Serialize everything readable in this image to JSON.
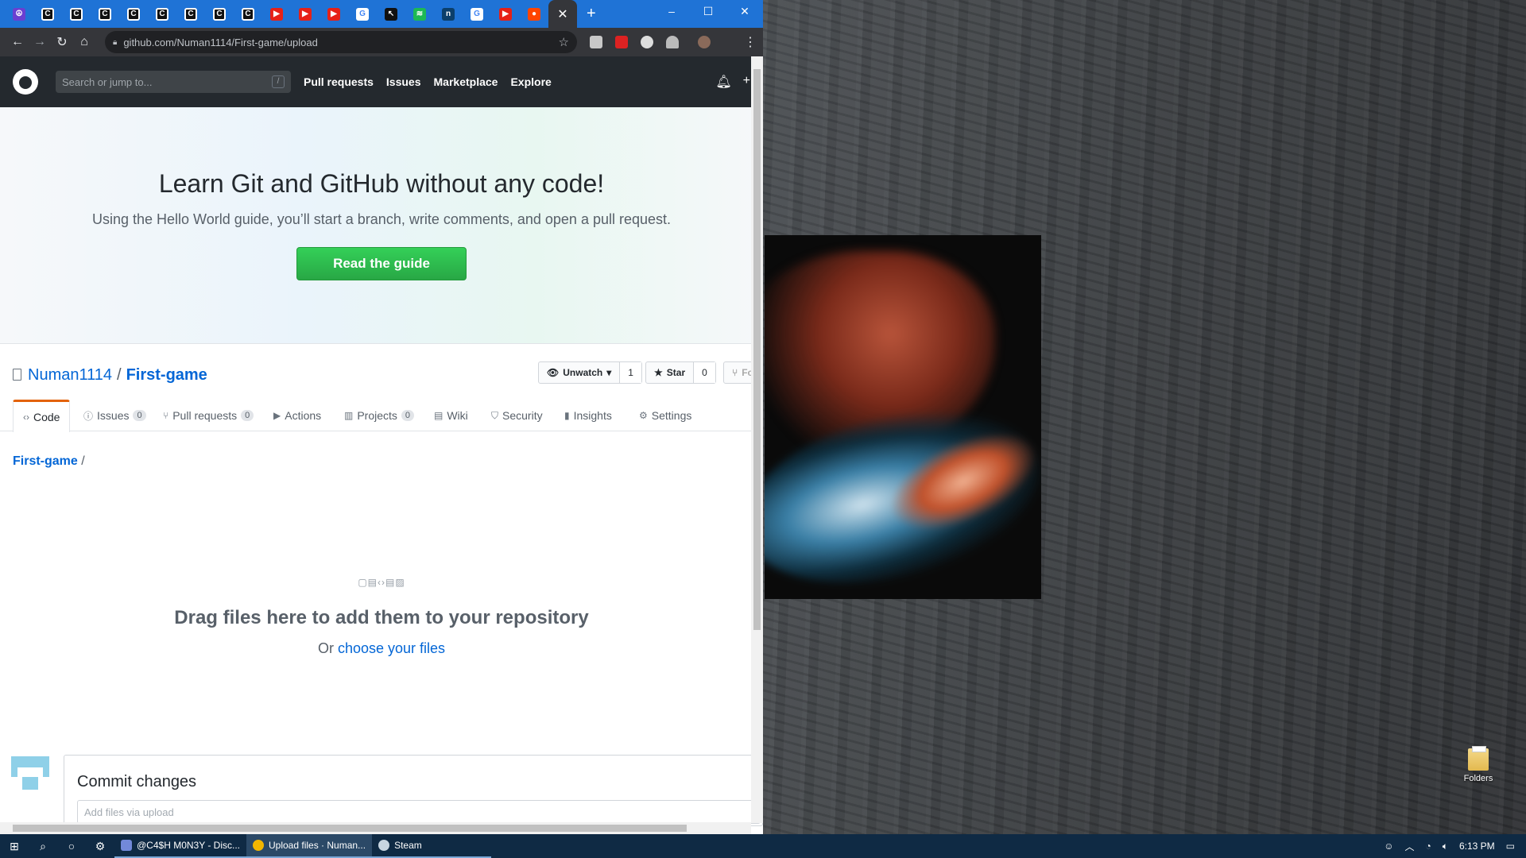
{
  "browser": {
    "tabs": [
      {
        "icon": "peace-icon",
        "color": "#6a3fd1",
        "glyph": "☮"
      },
      {
        "icon": "c-letter-icon",
        "color": "#111",
        "glyph": "C"
      },
      {
        "icon": "c-letter-icon",
        "color": "#111",
        "glyph": "C"
      },
      {
        "icon": "c-letter-icon",
        "color": "#111",
        "glyph": "C"
      },
      {
        "icon": "c-letter-icon",
        "color": "#111",
        "glyph": "C"
      },
      {
        "icon": "c-letter-icon",
        "color": "#111",
        "glyph": "C"
      },
      {
        "icon": "c-letter-icon",
        "color": "#111",
        "glyph": "C"
      },
      {
        "icon": "c-letter-icon",
        "color": "#111",
        "glyph": "C"
      },
      {
        "icon": "c-letter-icon",
        "color": "#111",
        "glyph": "C"
      },
      {
        "icon": "youtube-icon",
        "color": "#e62117",
        "glyph": "▶"
      },
      {
        "icon": "youtube-icon",
        "color": "#e62117",
        "glyph": "▶"
      },
      {
        "icon": "youtube-icon",
        "color": "#e62117",
        "glyph": "▶"
      },
      {
        "icon": "google-icon",
        "color": "#ffffff",
        "glyph": "G"
      },
      {
        "icon": "cursor-icon",
        "color": "#111",
        "glyph": "↖"
      },
      {
        "icon": "spotify-icon",
        "color": "#1db954",
        "glyph": "≋"
      },
      {
        "icon": "site-icon",
        "color": "#0b3f6b",
        "glyph": "n"
      },
      {
        "icon": "google-icon",
        "color": "#ffffff",
        "glyph": "G"
      },
      {
        "icon": "youtube-icon",
        "color": "#e62117",
        "glyph": "▶"
      },
      {
        "icon": "reddit-icon",
        "color": "#ff4500",
        "glyph": "●"
      }
    ],
    "active_tab_close": "✕",
    "new_tab": "+",
    "window_controls": {
      "minimize": "–",
      "maximize": "☐",
      "close": "✕"
    },
    "url": "github.com/Numan1114/First-game/upload"
  },
  "github": {
    "search_placeholder": "Search or jump to...",
    "search_shortcut": "/",
    "nav": [
      "Pull requests",
      "Issues",
      "Marketplace",
      "Explore"
    ],
    "hero": {
      "title": "Learn Git and GitHub without any code!",
      "subtitle": "Using the Hello World guide, you’ll start a branch, write comments, and open a pull request.",
      "button": "Read the guide"
    },
    "repo": {
      "owner": "Numan1114",
      "separator": "/",
      "name": "First-game",
      "unwatch_label": "Unwatch",
      "unwatch_count": "1",
      "star_label": "Star",
      "star_count": "0",
      "fork_label": "Fo"
    },
    "tabs": [
      {
        "label": "Code",
        "count": null,
        "icon": "‹›"
      },
      {
        "label": "Issues",
        "count": "0",
        "icon": "ⓘ"
      },
      {
        "label": "Pull requests",
        "count": "0",
        "icon": "⑂"
      },
      {
        "label": "Actions",
        "count": null,
        "icon": "▶"
      },
      {
        "label": "Projects",
        "count": "0",
        "icon": "▥"
      },
      {
        "label": "Wiki",
        "count": null,
        "icon": "▤"
      },
      {
        "label": "Security",
        "count": null,
        "icon": "⛉"
      },
      {
        "label": "Insights",
        "count": null,
        "icon": "▮"
      },
      {
        "label": "Settings",
        "count": null,
        "icon": "⚙"
      }
    ],
    "breadcrumb_root": "First-game",
    "breadcrumb_slash": "/",
    "dropzone": {
      "icons": "▢▤‹›▤▨",
      "title": "Drag files here to add them to your repository",
      "sub_prefix": "Or",
      "sub_link": "choose your files"
    },
    "commit": {
      "title": "Commit changes",
      "placeholder": "Add files via upload"
    }
  },
  "desktop": {
    "folder_label": "Folders"
  },
  "taskbar": {
    "apps": [
      {
        "label": "@C4$H M0N3Y - Disc...",
        "color": "#7289da",
        "active": false
      },
      {
        "label": "Upload files · Numan...",
        "color": "#f2b600",
        "active": true
      },
      {
        "label": "Steam",
        "color": "#1b2838",
        "active": false
      }
    ],
    "time": "6:13 PM"
  }
}
